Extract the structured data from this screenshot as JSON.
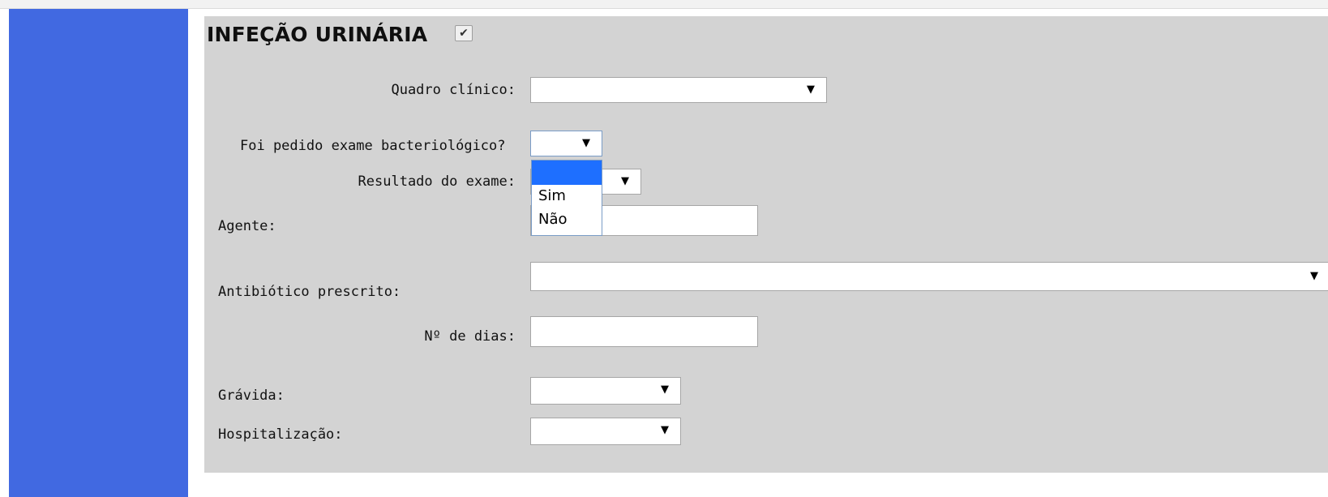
{
  "section": {
    "title": "INFEÇÃO URINÁRIA",
    "checked": true,
    "check_mark": "✔"
  },
  "fields": {
    "quadro_clinico": {
      "label": "Quadro clínico:",
      "value": ""
    },
    "exame_bacteriologico": {
      "label": "Foi pedido exame bacteriológico?",
      "value": "",
      "options": [
        "",
        "Sim",
        "Não"
      ]
    },
    "resultado_exame": {
      "label": "Resultado do exame:",
      "value": ""
    },
    "agente": {
      "label": "Agente:",
      "value": ""
    },
    "antibiotico": {
      "label": "Antibiótico prescrito:",
      "value": ""
    },
    "num_dias": {
      "label": "Nº de dias:",
      "value": ""
    },
    "gravida": {
      "label": "Grávida:",
      "value": ""
    },
    "hospitalizacao": {
      "label": "Hospitalização:",
      "value": ""
    }
  },
  "icons": {
    "dropdown_arrow": "▼"
  },
  "colors": {
    "sidebar": "#4169e1",
    "panel": "#d3d3d3",
    "highlight": "#1e6fff"
  }
}
